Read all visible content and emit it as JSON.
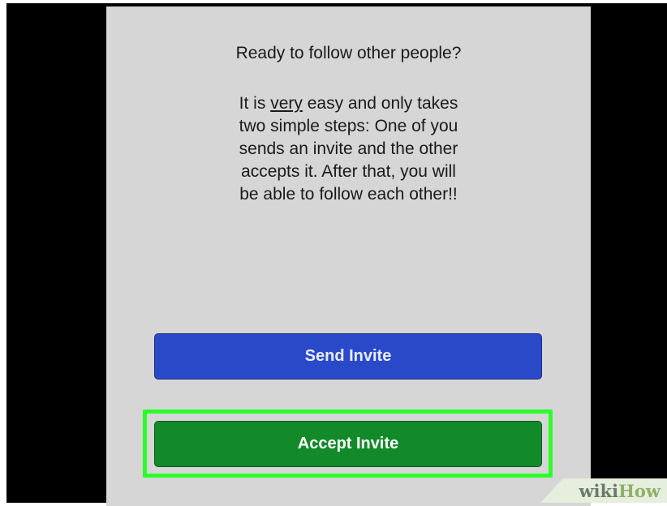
{
  "screen": {
    "prompt": "Ready to follow other people?",
    "body_lines": {
      "l1_pre": "It is ",
      "l1_emph": "very",
      "l1_post": " easy and only takes",
      "l2": "two simple steps: One of you",
      "l3": "sends an invite and the other",
      "l4": "accepts it. After that, you will",
      "l5": "be able to follow each other!!"
    },
    "send_button": "Send Invite",
    "accept_button": "Accept Invite"
  },
  "watermark": {
    "part1": "wiki",
    "part2": "How"
  },
  "colors": {
    "send_button": "#2a49c9",
    "accept_button": "#138a2a",
    "highlight": "#2bff2b",
    "screen_bg": "#d6d6d6"
  }
}
